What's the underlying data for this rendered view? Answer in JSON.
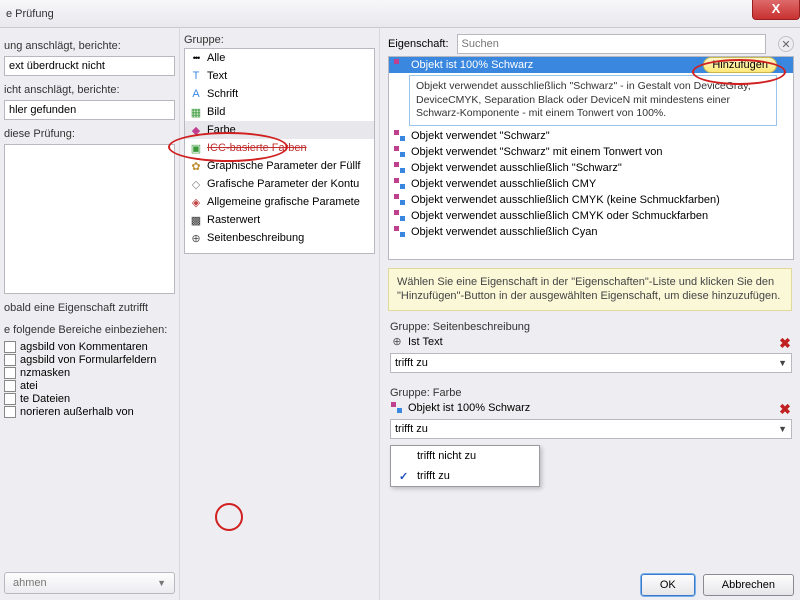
{
  "window": {
    "title": "e Prüfung"
  },
  "left": {
    "lbl_anschlaegt": "ung anschlägt, berichte:",
    "val_anschlaegt": "ext überdruckt nicht",
    "lbl_nicht": "icht anschlägt, berichte:",
    "val_nicht": "hler gefunden",
    "lbl_diese": "diese Prüfung:",
    "lbl_sobald": "obald eine Eigenschaft zutrifft",
    "lbl_bereiche": "e folgende Bereiche einbeziehen:",
    "items": [
      "agsbild von Kommentaren",
      "agsbild von Formularfeldern",
      "nzmasken",
      "atei",
      "te Dateien",
      "norieren außerhalb von"
    ],
    "btn": "ahmen"
  },
  "mid": {
    "lbl": "Gruppe:",
    "items": [
      {
        "id": "alle",
        "label": "Alle",
        "cls": "ic-alle"
      },
      {
        "id": "text",
        "label": "Text",
        "cls": "ic-text"
      },
      {
        "id": "schrift",
        "label": "Schrift",
        "cls": "ic-schrift"
      },
      {
        "id": "bild",
        "label": "Bild",
        "cls": "ic-bild"
      },
      {
        "id": "farbe",
        "label": "Farbe",
        "cls": "ic-farbe",
        "sel": true
      },
      {
        "id": "icc",
        "label": "ICC-basierte Farben",
        "cls": "ic-icc",
        "struck": true
      },
      {
        "id": "gp",
        "label": "Graphische Parameter der Füllf",
        "cls": "ic-gp"
      },
      {
        "id": "gk",
        "label": "Grafische Parameter der Kontu",
        "cls": "ic-gk"
      },
      {
        "id": "agp",
        "label": "Allgemeine grafische Paramete",
        "cls": "ic-agp"
      },
      {
        "id": "raster",
        "label": "Rasterwert",
        "cls": "ic-raster"
      },
      {
        "id": "seite",
        "label": "Seitenbeschreibung",
        "cls": "ic-seite"
      }
    ]
  },
  "right": {
    "lbl": "Eigenschaft:",
    "search_ph": "Suchen",
    "addbtn": "Hinzufügen",
    "first": "Objekt ist 100% Schwarz",
    "desc": "Objekt verwendet ausschließlich \"Schwarz\" - in Gestalt von DeviceGray, DeviceCMYK, Separation Black oder DeviceN mit mindestens einer Schwarz-Komponente - mit einem Tonwert von 100%.",
    "rest": [
      "Objekt verwendet \"Schwarz\"",
      "Objekt verwendet \"Schwarz\" mit einem Tonwert von",
      "Objekt verwendet ausschließlich \"Schwarz\"",
      "Objekt verwendet ausschließlich CMY",
      "Objekt verwendet ausschließlich CMYK (keine Schmuckfarben)",
      "Objekt verwendet ausschließlich CMYK oder Schmuckfarben",
      "Objekt verwendet ausschließlich Cyan"
    ],
    "hint": "Wählen Sie eine Eigenschaft in der \"Eigenschaften\"-Liste und klicken Sie den \"Hinzufügen\"-Button in der ausgewählten Eigenschaft, um diese hinzuzufügen.",
    "cond1_group": "Gruppe: Seitenbeschreibung",
    "cond1_obj": "Ist Text",
    "cond1_sel": "trifft zu",
    "cond2_group": "Gruppe: Farbe",
    "cond2_obj": "Objekt ist 100% Schwarz",
    "cond2_sel": "trifft zu",
    "dd_opt1": "trifft nicht zu",
    "dd_opt2": "trifft zu"
  },
  "footer": {
    "ok": "OK",
    "cancel": "Abbrechen"
  }
}
